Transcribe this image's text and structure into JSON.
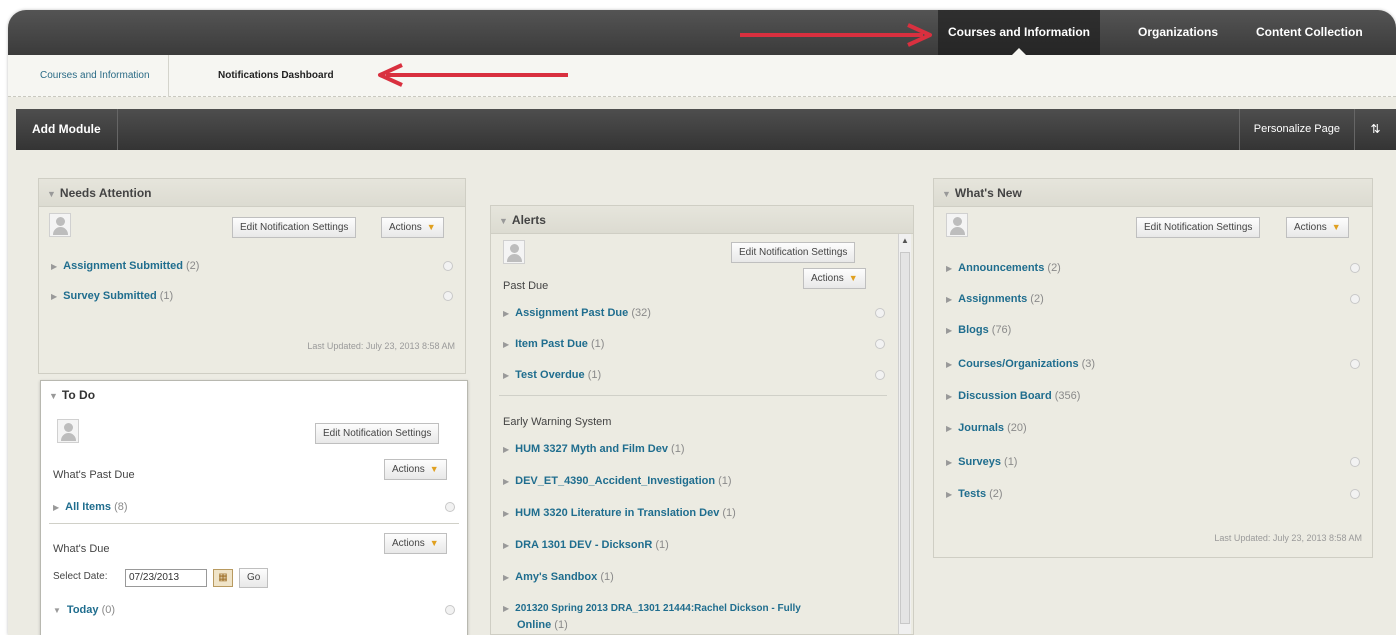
{
  "topnav": {
    "tabs": [
      {
        "label": "Courses and Information",
        "active": true
      },
      {
        "label": "Organizations",
        "active": false
      },
      {
        "label": "Content Collection",
        "active": false
      }
    ]
  },
  "subnav": {
    "courses_link": "Courses and Information",
    "current": "Notifications Dashboard"
  },
  "actionbar": {
    "add_module": "Add Module",
    "personalize": "Personalize Page",
    "sort_icon": "⇅"
  },
  "needs_attention": {
    "title": "Needs Attention",
    "edit_button": "Edit Notification Settings",
    "actions_button": "Actions",
    "items": [
      {
        "label": "Assignment Submitted",
        "count": "(2)"
      },
      {
        "label": "Survey Submitted",
        "count": "(1)"
      }
    ],
    "updated": "Last Updated: July 23, 2013 8:58 AM"
  },
  "todo": {
    "title": "To Do",
    "edit_button": "Edit Notification Settings",
    "past_due_heading": "What's Past Due",
    "actions_button": "Actions",
    "all_items": {
      "label": "All Items",
      "count": "(8)"
    },
    "due_heading": "What's Due",
    "select_date_label": "Select Date:",
    "date_value": "07/23/2013",
    "go_button": "Go",
    "today": {
      "label": "Today",
      "count": "(0)"
    }
  },
  "alerts": {
    "title": "Alerts",
    "edit_button": "Edit Notification Settings",
    "actions_button": "Actions",
    "past_due_heading": "Past Due",
    "past_due_items": [
      {
        "label": "Assignment Past Due",
        "count": "(32)"
      },
      {
        "label": "Item Past Due",
        "count": "(1)"
      },
      {
        "label": "Test Overdue",
        "count": "(1)"
      }
    ],
    "ews_heading": "Early Warning System",
    "ews_items": [
      {
        "label": "HUM 3327 Myth and Film Dev",
        "count": "(1)"
      },
      {
        "label": "DEV_ET_4390_Accident_Investigation",
        "count": "(1)"
      },
      {
        "label": "HUM 3320 Literature in Translation Dev",
        "count": "(1)"
      },
      {
        "label": "DRA 1301 DEV - DicksonR",
        "count": "(1)"
      },
      {
        "label": "Amy's Sandbox",
        "count": "(1)"
      },
      {
        "label": "201320 Spring 2013 DRA_1301 21444:Rachel Dickson - Fully",
        "label2": "Online",
        "count": "(1)"
      }
    ]
  },
  "whats_new": {
    "title": "What's New",
    "edit_button": "Edit Notification Settings",
    "actions_button": "Actions",
    "items": [
      {
        "label": "Announcements",
        "count": "(2)"
      },
      {
        "label": "Assignments",
        "count": "(2)"
      },
      {
        "label": "Blogs",
        "count": "(76)"
      },
      {
        "label": "Courses/Organizations",
        "count": "(3)"
      },
      {
        "label": "Discussion Board",
        "count": "(356)"
      },
      {
        "label": "Journals",
        "count": "(20)"
      },
      {
        "label": "Surveys",
        "count": "(1)"
      },
      {
        "label": "Tests",
        "count": "(2)"
      }
    ],
    "updated": "Last Updated: July 23, 2013 8:58 AM"
  },
  "colors": {
    "link": "#1f6d8e",
    "annotation_arrow": "#d9303f",
    "actions_caret": "#e0a020"
  },
  "icons": {
    "avatar": "user-avatar-icon",
    "expand": "triangle-right-icon",
    "collapse": "triangle-down-icon",
    "calendar": "calendar-icon",
    "status": "status-circle-icon"
  }
}
